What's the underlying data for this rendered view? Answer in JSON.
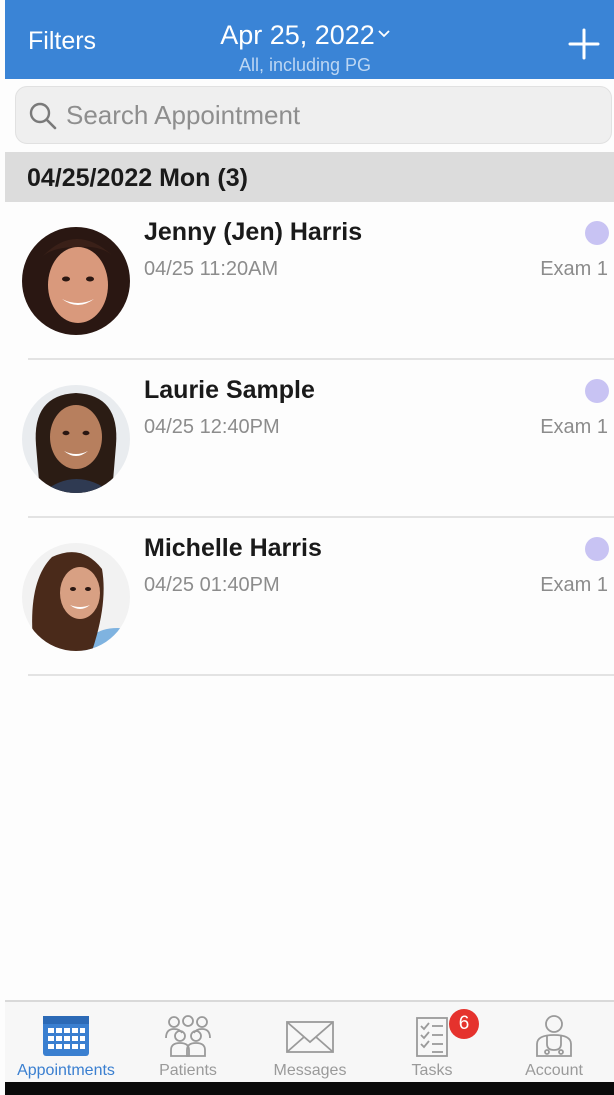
{
  "header": {
    "filters_label": "Filters",
    "date": "Apr 25, 2022",
    "date_chevron": "⌄",
    "subtitle": "All, including PG"
  },
  "search": {
    "placeholder": "Search Appointment"
  },
  "section": {
    "title": "04/25/2022 Mon (3)"
  },
  "appointments": [
    {
      "name": "Jenny (Jen) Harris",
      "time": "04/25 11:20AM",
      "room": "Exam 1"
    },
    {
      "name": "Laurie Sample",
      "time": "04/25 12:40PM",
      "room": "Exam 1"
    },
    {
      "name": "Michelle Harris",
      "time": "04/25 01:40PM",
      "room": "Exam 1"
    }
  ],
  "tabs": [
    {
      "label": "Appointments",
      "icon": "calendar-icon"
    },
    {
      "label": "Patients",
      "icon": "people-icon"
    },
    {
      "label": "Messages",
      "icon": "envelope-icon"
    },
    {
      "label": "Tasks",
      "icon": "checklist-icon",
      "badge": "6"
    },
    {
      "label": "Account",
      "icon": "doctor-icon"
    }
  ],
  "colors": {
    "header_blue": "#3a84d6",
    "status_dot": "#c8c3f3",
    "active_tab": "#3a7fd0",
    "badge_red": "#e5322d"
  }
}
